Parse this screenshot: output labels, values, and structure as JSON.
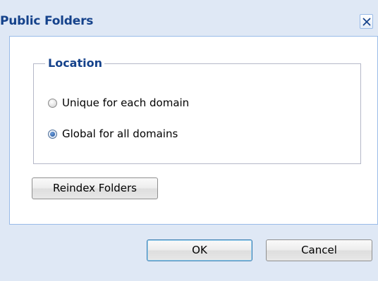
{
  "dialog": {
    "title": "Public Folders",
    "close_icon": "close-icon"
  },
  "location": {
    "legend": "Location",
    "options": [
      {
        "label": "Unique for each domain",
        "checked": false
      },
      {
        "label": "Global for all domains",
        "checked": true
      }
    ]
  },
  "actions": {
    "reindex_label": "Reindex Folders",
    "ok_label": "OK",
    "cancel_label": "Cancel"
  },
  "colors": {
    "title_text": "#15428b",
    "dialog_background": "#dfe8f5",
    "panel_border": "#99bbe8"
  }
}
